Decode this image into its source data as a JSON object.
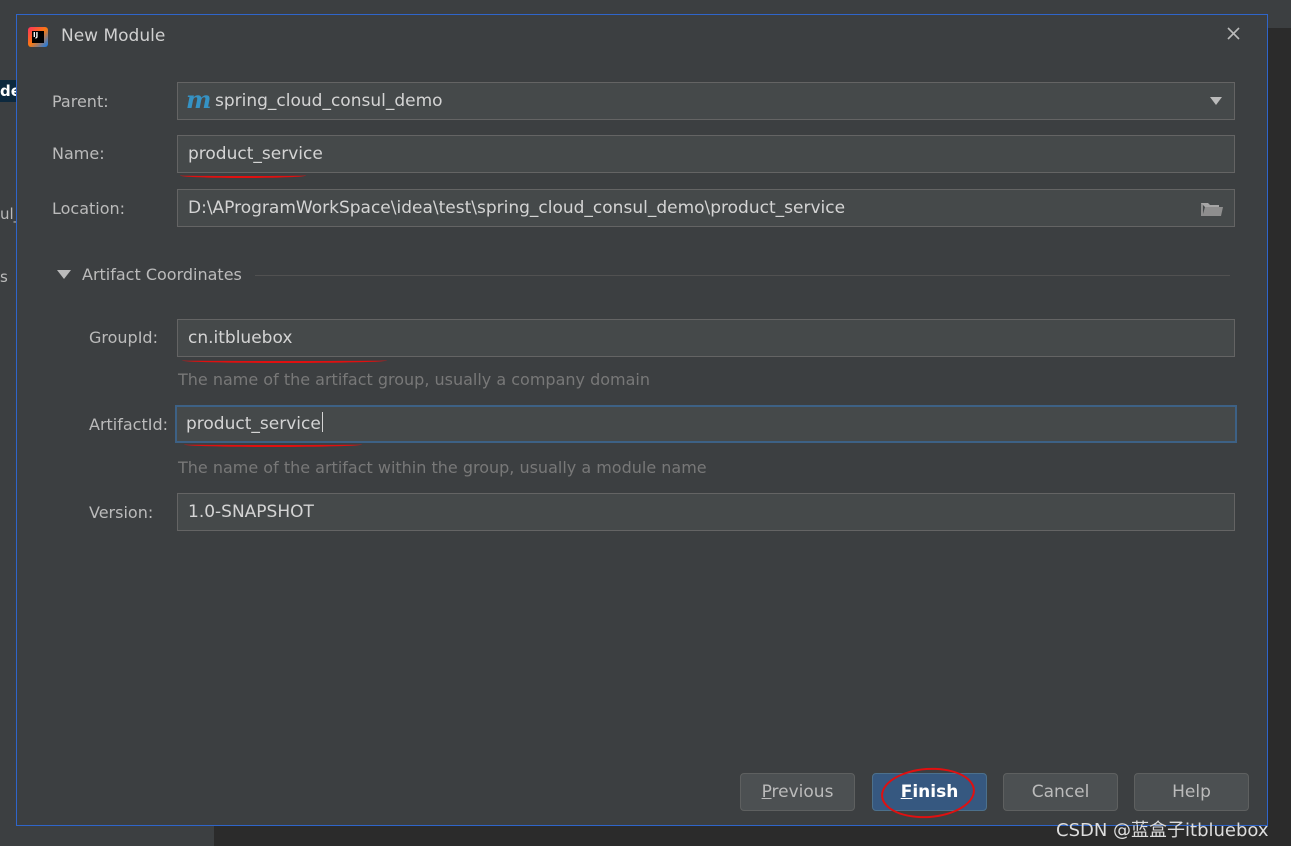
{
  "background": {
    "fragments": [
      "de",
      "ul_",
      "s"
    ]
  },
  "dialog": {
    "title": "New Module",
    "app_icon_letters": "IJ",
    "fields": {
      "parent_label": "Parent:",
      "parent_value": "spring_cloud_consul_demo",
      "parent_icon_letter": "m",
      "name_label": "Name:",
      "name_value": "product_service",
      "location_label": "Location:",
      "location_value": "D:\\AProgramWorkSpace\\idea\\test\\spring_cloud_consul_demo\\product_service"
    },
    "artifact": {
      "section_title": "Artifact Coordinates",
      "groupid_label": "GroupId:",
      "groupid_value": "cn.itbluebox",
      "groupid_hint": "The name of the artifact group, usually a company domain",
      "artifactid_label": "ArtifactId:",
      "artifactid_value": "product_service",
      "artifactid_hint": "The name of the artifact within the group, usually a module name",
      "version_label": "Version:",
      "version_value": "1.0-SNAPSHOT"
    },
    "buttons": {
      "previous_mnemonic": "P",
      "previous_rest": "revious",
      "finish_mnemonic": "F",
      "finish_rest": "inish",
      "cancel": "Cancel",
      "help": "Help"
    }
  },
  "watermark": "CSDN @蓝盒子itbluebox",
  "colors": {
    "dialog_bg": "#3c3f41",
    "field_bg": "#45494a",
    "accent": "#365880",
    "annotation_red": "#e01010",
    "maven_icon": "#3592c4"
  }
}
